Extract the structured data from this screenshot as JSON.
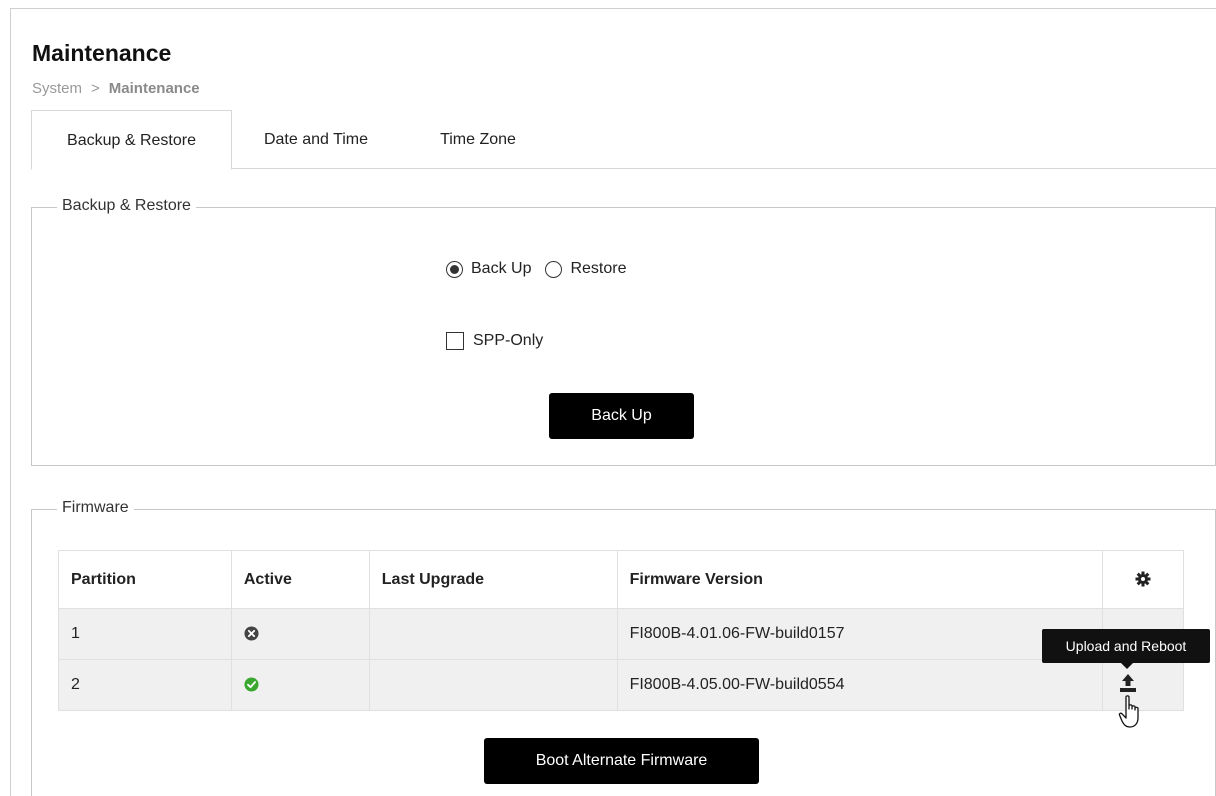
{
  "header": {
    "title": "Maintenance",
    "breadcrumb": {
      "parent": "System",
      "separator": ">",
      "current": "Maintenance"
    }
  },
  "tabs": [
    {
      "label": "Backup & Restore",
      "active": true
    },
    {
      "label": "Date and Time",
      "active": false
    },
    {
      "label": "Time Zone",
      "active": false
    }
  ],
  "backup_restore": {
    "legend": "Backup & Restore",
    "radio_options": [
      {
        "label": "Back Up",
        "checked": true
      },
      {
        "label": "Restore",
        "checked": false
      }
    ],
    "spp_only": {
      "label": "SPP-Only",
      "checked": false
    },
    "action_button": "Back Up"
  },
  "firmware": {
    "legend": "Firmware",
    "columns": [
      "Partition",
      "Active",
      "Last Upgrade",
      "Firmware Version"
    ],
    "action_column_icon": "gear-icon",
    "rows": [
      {
        "partition": "1",
        "active": false,
        "active_icon": "inactive-x-icon",
        "last_upgrade": "",
        "version": "FI800B-4.01.06-FW-build0157"
      },
      {
        "partition": "2",
        "active": true,
        "active_icon": "active-check-icon",
        "last_upgrade": "",
        "version": "FI800B-4.05.00-FW-build0554"
      }
    ],
    "boot_button": "Boot Alternate Firmware",
    "upload_tooltip": "Upload and Reboot"
  },
  "colors": {
    "button_bg": "#000000",
    "active_green": "#3aa82f",
    "inactive_gray": "#444444"
  }
}
